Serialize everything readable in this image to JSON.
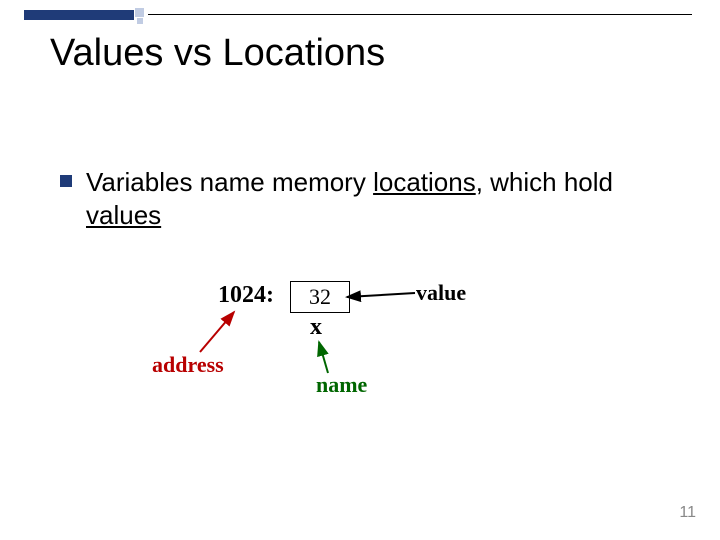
{
  "title": "Values vs Locations",
  "bullet": {
    "pre": "Variables name memory ",
    "u1": "locations",
    "mid": ", which hold ",
    "u2": "values"
  },
  "diagram": {
    "addr_label": "1024:",
    "box_value": "32",
    "var_name": "x",
    "value_label": "value",
    "address_label": "address",
    "name_label": "name"
  },
  "page_number": "11",
  "colors": {
    "accent": "#1f3b78",
    "address": "#b80000",
    "name": "#006600"
  }
}
